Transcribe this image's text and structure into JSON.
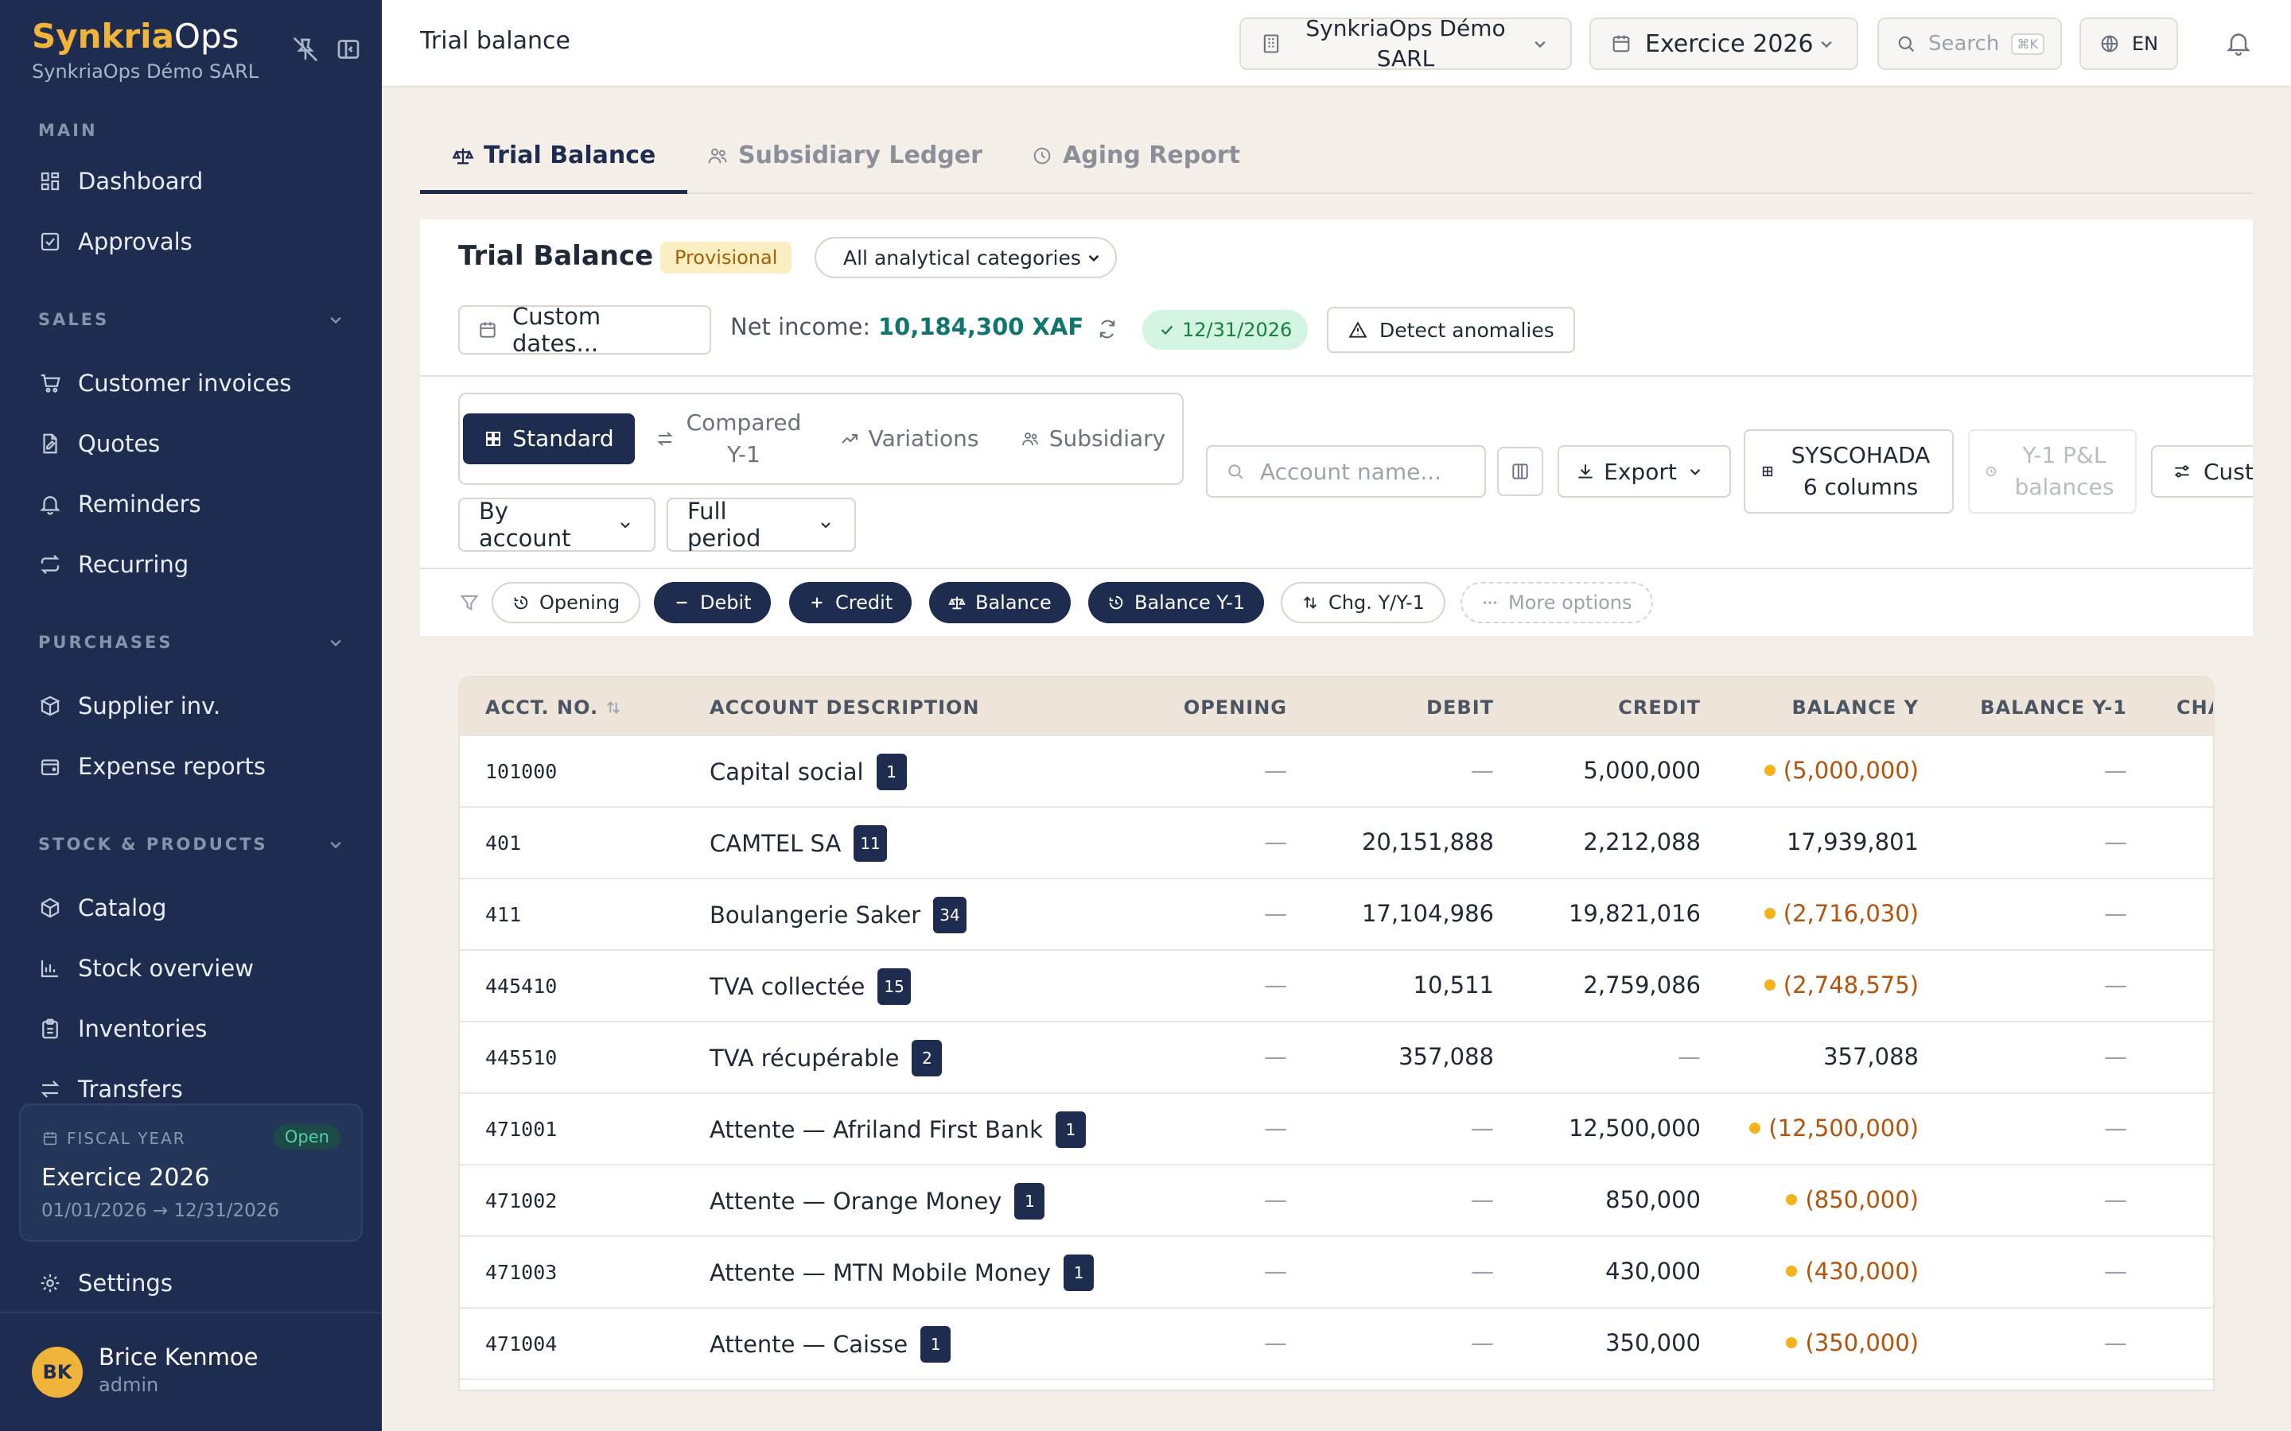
{
  "sidebar": {
    "brand_part1": "Synkria",
    "brand_part2": "Ops",
    "org_name": "SynkriaOps Démo SARL",
    "sections": {
      "main": "MAIN",
      "sales": "SALES",
      "purchases": "PURCHASES",
      "stock": "STOCK & PRODUCTS"
    },
    "items": {
      "dashboard": "Dashboard",
      "approvals": "Approvals",
      "customer_invoices": "Customer invoices",
      "quotes": "Quotes",
      "reminders": "Reminders",
      "recurring": "Recurring",
      "supplier_inv": "Supplier inv.",
      "expense_reports": "Expense reports",
      "catalog": "Catalog",
      "stock_overview": "Stock overview",
      "inventories": "Inventories",
      "transfers": "Transfers",
      "settings": "Settings"
    },
    "fiscal_year": {
      "label": "FISCAL YEAR",
      "status": "Open",
      "title": "Exercice 2026",
      "range": "01/01/2026 → 12/31/2026"
    },
    "user": {
      "initials": "BK",
      "name": "Brice Kenmoe",
      "role": "admin"
    }
  },
  "topbar": {
    "page_title": "Trial balance",
    "org_selector": "SynkriaOps Démo SARL",
    "fiscal_selector": "Exercice 2026",
    "search_label": "Search",
    "search_shortcut": "⌘K",
    "language": "EN"
  },
  "tabs": [
    {
      "label": "Trial Balance",
      "active": true
    },
    {
      "label": "Subsidiary Ledger",
      "active": false
    },
    {
      "label": "Aging Report",
      "active": false
    }
  ],
  "panel": {
    "title": "Trial Balance",
    "status_badge": "Provisional",
    "category_select": "All analytical categories",
    "custom_dates": "Custom dates...",
    "net_income_label": "Net income:",
    "net_income_value": "10,184,300 XAF",
    "date_badge": "12/31/2026",
    "detect_anomalies": "Detect anomalies"
  },
  "toolbar": {
    "views": {
      "standard": "Standard",
      "compared": "Compared Y-1",
      "variations": "Variations",
      "subsidiary": "Subsidiary"
    },
    "account_search_placeholder": "Account name...",
    "export": "Export",
    "syscohada": "SYSCOHADA 6 columns",
    "y1_pl": "Y-1 P&L balances",
    "customize": "Custo",
    "group_by": "By account",
    "period": "Full period"
  },
  "filters": {
    "opening": "Opening",
    "debit": "Debit",
    "credit": "Credit",
    "balance": "Balance",
    "balance_y1": "Balance Y-1",
    "chg": "Chg. Y/Y-1",
    "more": "More options"
  },
  "table": {
    "headers": {
      "acct": "ACCT. NO.",
      "desc": "ACCOUNT DESCRIPTION",
      "opening": "OPENING",
      "debit": "DEBIT",
      "credit": "CREDIT",
      "balance": "BALANCE Y",
      "balance_y1": "BALANCE Y-1",
      "chg": "CHA"
    },
    "rows": [
      {
        "acct": "101000",
        "desc": "Capital social",
        "count": "1",
        "opening": "—",
        "debit": "—",
        "credit": "5,000,000",
        "balance": "(5,000,000)",
        "negative": true,
        "balance_y1": "—"
      },
      {
        "acct": "401",
        "desc": "CAMTEL SA",
        "count": "11",
        "opening": "—",
        "debit": "20,151,888",
        "credit": "2,212,088",
        "balance": "17,939,801",
        "negative": false,
        "balance_y1": "—"
      },
      {
        "acct": "411",
        "desc": "Boulangerie Saker",
        "count": "34",
        "opening": "—",
        "debit": "17,104,986",
        "credit": "19,821,016",
        "balance": "(2,716,030)",
        "negative": true,
        "balance_y1": "—"
      },
      {
        "acct": "445410",
        "desc": "TVA collectée",
        "count": "15",
        "opening": "—",
        "debit": "10,511",
        "credit": "2,759,086",
        "balance": "(2,748,575)",
        "negative": true,
        "balance_y1": "—"
      },
      {
        "acct": "445510",
        "desc": "TVA récupérable",
        "count": "2",
        "opening": "—",
        "debit": "357,088",
        "credit": "—",
        "balance": "357,088",
        "negative": false,
        "balance_y1": "—"
      },
      {
        "acct": "471001",
        "desc": "Attente — Afriland First Bank",
        "count": "1",
        "opening": "—",
        "debit": "—",
        "credit": "12,500,000",
        "balance": "(12,500,000)",
        "negative": true,
        "balance_y1": "—"
      },
      {
        "acct": "471002",
        "desc": "Attente — Orange Money",
        "count": "1",
        "opening": "—",
        "debit": "—",
        "credit": "850,000",
        "balance": "(850,000)",
        "negative": true,
        "balance_y1": "—"
      },
      {
        "acct": "471003",
        "desc": "Attente — MTN Mobile Money",
        "count": "1",
        "opening": "—",
        "debit": "—",
        "credit": "430,000",
        "balance": "(430,000)",
        "negative": true,
        "balance_y1": "—"
      },
      {
        "acct": "471004",
        "desc": "Attente — Caisse",
        "count": "1",
        "opening": "—",
        "debit": "—",
        "credit": "350,000",
        "balance": "(350,000)",
        "negative": true,
        "balance_y1": "—"
      }
    ]
  }
}
